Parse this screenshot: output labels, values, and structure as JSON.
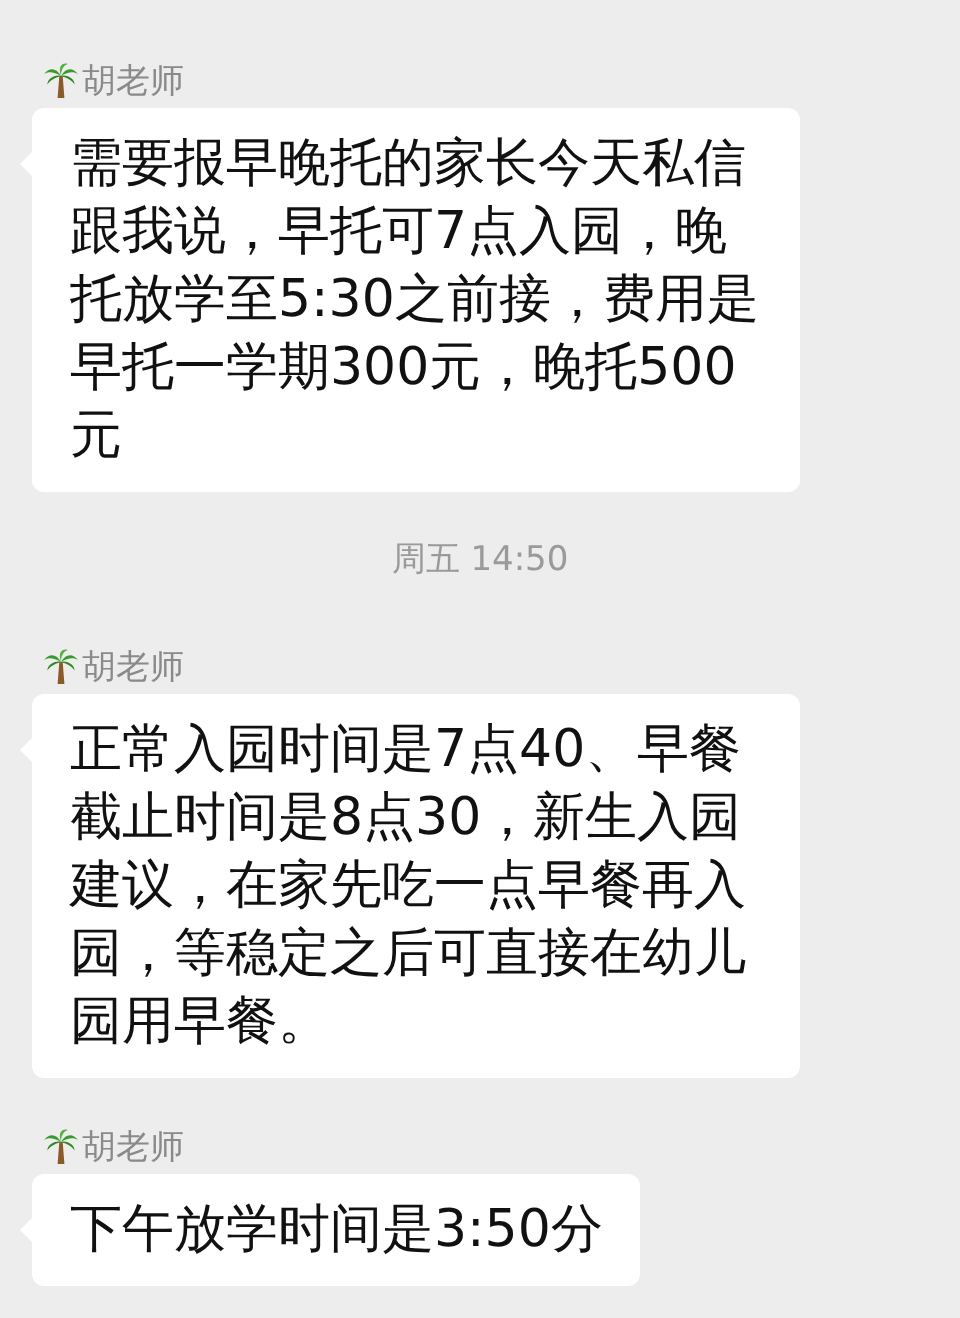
{
  "messages": [
    {
      "kind": "message",
      "sender": "胡老师",
      "text": "需要报早晚托的家长今天私信跟我说，早托可7点入园，晚托放学至5:30之前接，费用是早托一学期300元，晚托500元"
    },
    {
      "kind": "time",
      "text": "周五 14:50"
    },
    {
      "kind": "message",
      "sender": "胡老师",
      "text": "正常入园时间是7点40、早餐截止时间是8点30，新生入园建议，在家先吃一点早餐再入园，等稳定之后可直接在幼儿园用早餐。"
    },
    {
      "kind": "message",
      "sender": "胡老师",
      "text": "下午放学时间是3:50分"
    }
  ]
}
